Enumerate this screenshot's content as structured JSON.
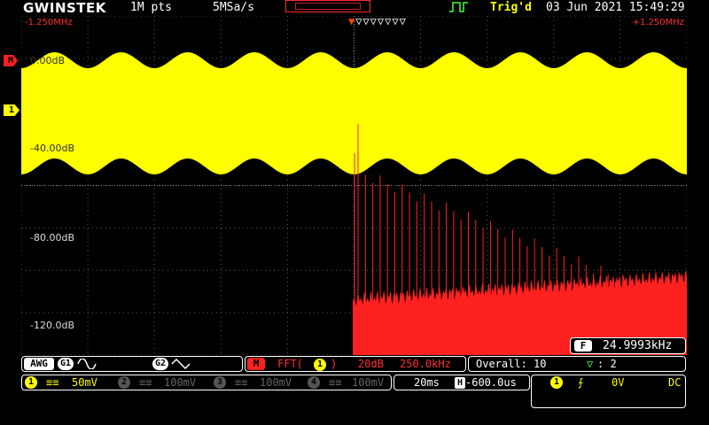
{
  "header": {
    "logo": "GWINSTEK",
    "mem_points": "1M pts",
    "sample_rate": "5MSa/s",
    "trigger_status": "Trig'd",
    "datetime": "03 Jun 2021 15:49:29"
  },
  "fft": {
    "freq_left": "-1.250MHz",
    "freq_right": "+1.250MHz",
    "db_labels": [
      "0.00dB",
      "-40.00dB",
      "-80.00dB",
      "-120.0dB"
    ]
  },
  "markers": {
    "math": "M",
    "ch1": "1"
  },
  "trigger_markers": "▽▽▽▽▽▽▽",
  "frequency_readout": {
    "badge": "F",
    "value": "24.9993kHz"
  },
  "awg": {
    "label": "AWG",
    "g1": "G1",
    "g2": "G2"
  },
  "math": {
    "badge": "M",
    "text": "FFT(",
    "ch": "1",
    "close": ")",
    "scale": "20dB",
    "span": "250.0kHz"
  },
  "overall": {
    "text": "Overall: 10",
    "sym": "▽",
    "val": ": 2"
  },
  "channels": [
    {
      "num": "1",
      "coupling": "≡≡",
      "scale": "50mV"
    },
    {
      "num": "2",
      "coupling": "≡≡",
      "scale": "100mV"
    },
    {
      "num": "3",
      "coupling": "≡≡",
      "scale": "100mV"
    },
    {
      "num": "4",
      "coupling": "≡≡",
      "scale": "100mV"
    }
  ],
  "timebase": {
    "scale": "20ms",
    "h_badge": "H",
    "position": "-600.0us"
  },
  "trigger": {
    "source": "1",
    "slope": "⨍",
    "level": "0V",
    "coupling": "DC"
  },
  "colors": {
    "ch1": "#ffff00",
    "math": "#ff2020",
    "background": "#000000"
  }
}
